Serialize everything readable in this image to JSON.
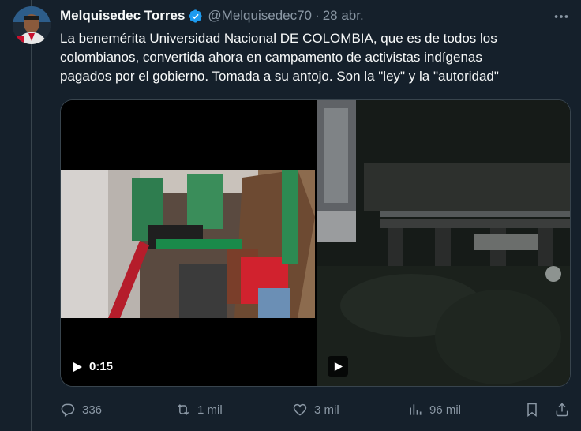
{
  "author": {
    "display_name": "Melquisedec Torres",
    "handle": "@Melquisedec70",
    "separator": "·",
    "date": "28 abr.",
    "verified": true
  },
  "tweet": {
    "text_lines": [
      "La benemérita Universidad Nacional DE COLOMBIA, que es de todos los",
      "colombianos, convertida ahora en campamento de activistas indígenas",
      "pagados por el gobierno. Tomada a su antojo. Son la \"ley\" y la \"autoridad\""
    ]
  },
  "media": {
    "videos": [
      {
        "duration": "0:15"
      },
      {
        "duration": ""
      }
    ]
  },
  "actions": {
    "replies": "336",
    "retweets": "1 mil",
    "likes": "3 mil",
    "views": "96 mil"
  },
  "colors": {
    "background": "#15202b",
    "text_primary": "#f7f9f9",
    "text_secondary": "#8b98a5",
    "verified": "#1d9bf0",
    "border": "#38444d"
  }
}
